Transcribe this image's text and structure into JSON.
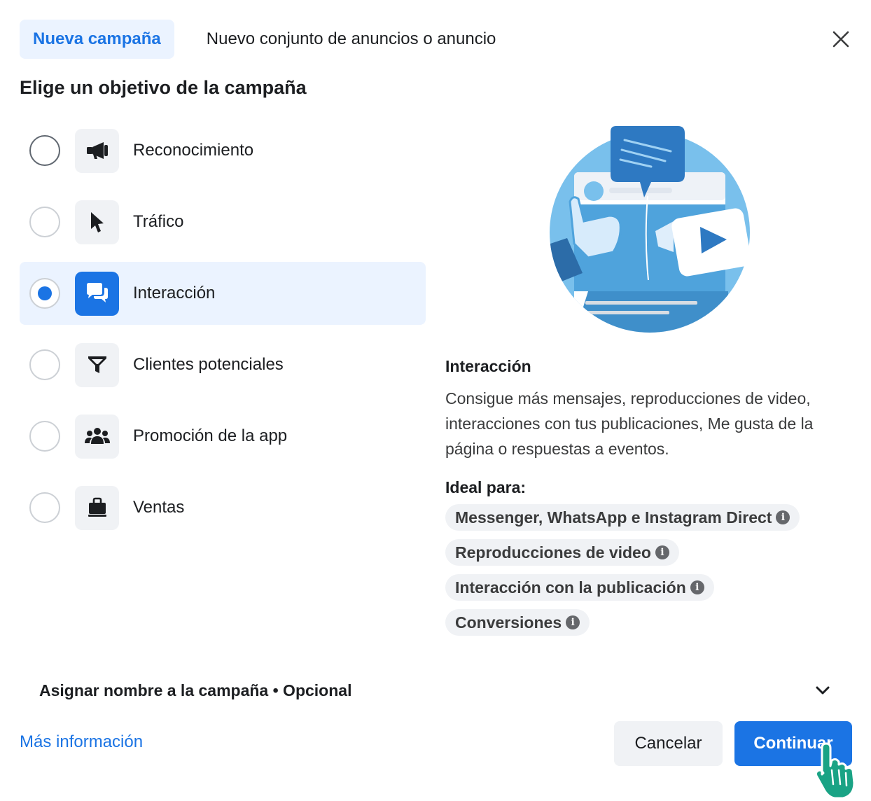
{
  "tabs": {
    "active": "Nueva campaña",
    "inactive": "Nuevo conjunto de anuncios o anuncio"
  },
  "heading": "Elige un objetivo de la campaña",
  "objectives": [
    {
      "label": "Reconocimiento",
      "icon": "megaphone-icon",
      "selected": false
    },
    {
      "label": "Tráfico",
      "icon": "cursor-icon",
      "selected": false
    },
    {
      "label": "Interacción",
      "icon": "chat-bubbles-icon",
      "selected": true
    },
    {
      "label": "Clientes potenciales",
      "icon": "funnel-icon",
      "selected": false
    },
    {
      "label": "Promoción de la app",
      "icon": "people-icon",
      "selected": false
    },
    {
      "label": "Ventas",
      "icon": "shopping-bag-icon",
      "selected": false
    }
  ],
  "description": {
    "title": "Interacción",
    "text": "Consigue más mensajes, reproducciones de video, interacciones con tus publicaciones, Me gusta de la página o respuestas a eventos.",
    "ideal_label": "Ideal para:",
    "chips": [
      "Messenger, WhatsApp e Instagram Direct",
      "Reproducciones de video",
      "Interacción con la publicación",
      "Conversiones"
    ]
  },
  "campaign_name": {
    "label": "Asignar nombre a la campaña • Opcional"
  },
  "footer": {
    "more_info": "Más información",
    "cancel": "Cancelar",
    "continue": "Continuar"
  },
  "colors": {
    "accent": "#1b74e4",
    "selected_bg": "#ebf3ff",
    "chip_bg": "#f0f2f5",
    "hand_cursor": "#1aa385"
  }
}
